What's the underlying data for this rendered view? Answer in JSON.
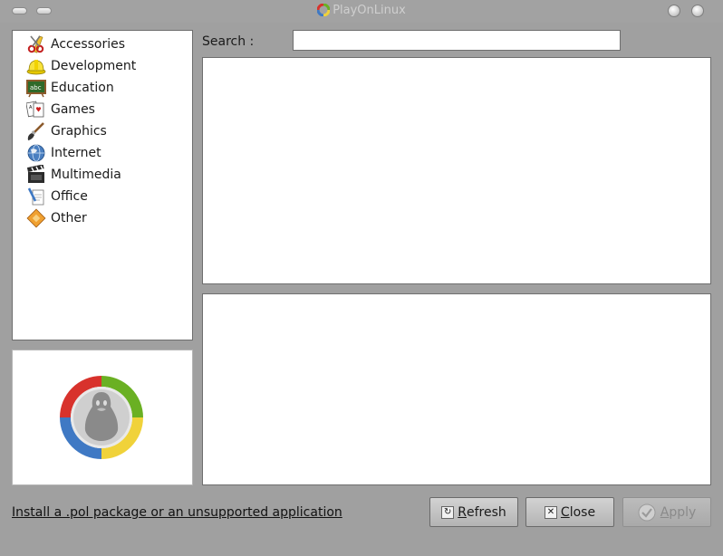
{
  "window": {
    "title": "PlayOnLinux"
  },
  "categories": [
    {
      "label": "Accessories",
      "icon": "scissors-ruler-icon"
    },
    {
      "label": "Development",
      "icon": "hardhat-icon"
    },
    {
      "label": "Education",
      "icon": "chalkboard-icon"
    },
    {
      "label": "Games",
      "icon": "playing-cards-icon"
    },
    {
      "label": "Graphics",
      "icon": "paintbrush-icon"
    },
    {
      "label": "Internet",
      "icon": "globe-icon"
    },
    {
      "label": "Multimedia",
      "icon": "clapperboard-icon"
    },
    {
      "label": "Office",
      "icon": "pen-paper-icon"
    },
    {
      "label": "Other",
      "icon": "diamond-icon"
    }
  ],
  "search": {
    "label": "Search :",
    "value": ""
  },
  "footer": {
    "install_link": "Install a .pol package or an unsupported application"
  },
  "buttons": {
    "refresh": {
      "mnemonic": "R",
      "rest": "efresh"
    },
    "close": {
      "mnemonic": "C",
      "rest": "lose"
    },
    "apply": {
      "mnemonic": "A",
      "rest": "pply"
    }
  },
  "colors": {
    "logo_green": "#6ab023",
    "logo_yellow": "#f0d23a",
    "logo_blue": "#3f79c4",
    "logo_red": "#d8322c"
  }
}
